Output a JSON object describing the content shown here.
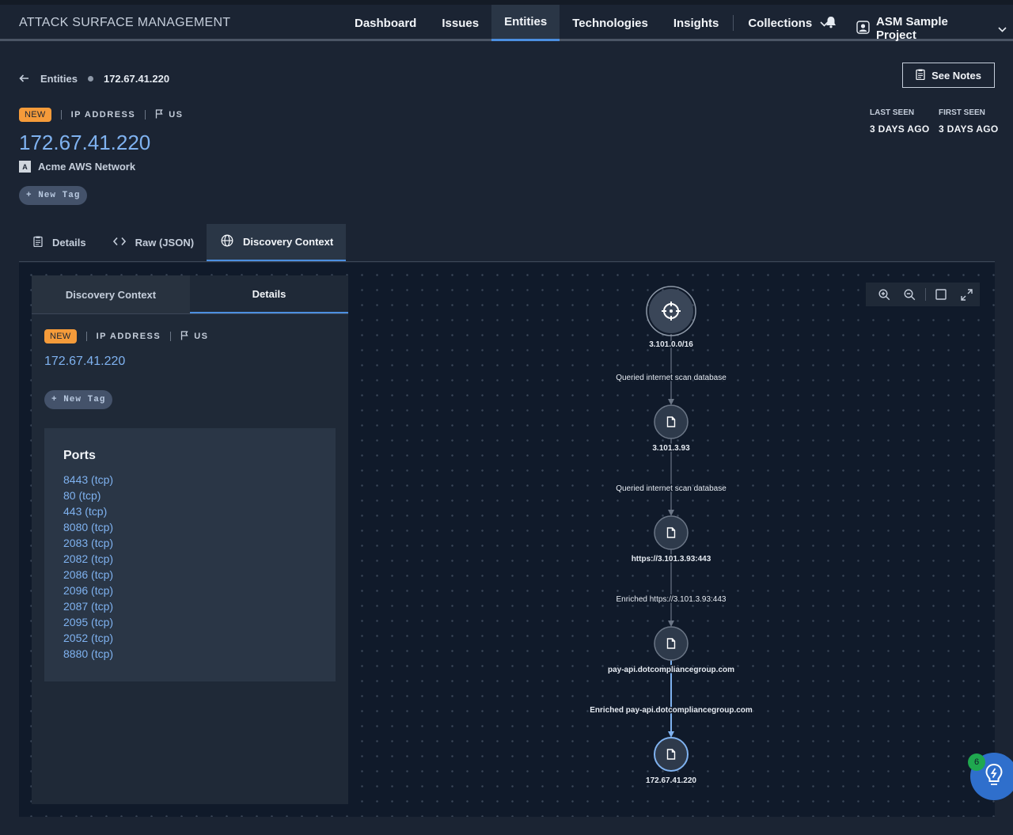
{
  "header": {
    "brand": "ATTACK SURFACE MANAGEMENT",
    "nav": [
      {
        "label": "Dashboard",
        "active": false
      },
      {
        "label": "Issues",
        "active": false
      },
      {
        "label": "Entities",
        "active": true
      },
      {
        "label": "Technologies",
        "active": false
      },
      {
        "label": "Insights",
        "active": false
      },
      {
        "label": "Collections",
        "active": false
      }
    ],
    "project": "ASM Sample Project"
  },
  "breadcrumb": {
    "parent": "Entities",
    "current": "172.67.41.220"
  },
  "see_notes": "See Notes",
  "entity": {
    "badge": "NEW",
    "type": "IP ADDRESS",
    "country": "US",
    "ip": "172.67.41.220",
    "network_letter": "A",
    "network": "Acme AWS Network",
    "new_tag": "+ New Tag",
    "last_seen_label": "LAST SEEN",
    "last_seen": "3 DAYS AGO",
    "first_seen_label": "FIRST SEEN",
    "first_seen": "3 DAYS AGO"
  },
  "tabs": [
    {
      "label": "Details",
      "icon": "clipboard-icon"
    },
    {
      "label": "Raw (JSON)",
      "icon": "code-icon"
    },
    {
      "label": "Discovery Context",
      "icon": "globe-icon",
      "active": true
    }
  ],
  "side_panel": {
    "tabs": [
      "Discovery Context",
      "Details"
    ],
    "active_tab": "Details",
    "badge": "NEW",
    "type": "IP ADDRESS",
    "country": "US",
    "ip": "172.67.41.220",
    "new_tag": "+ New Tag",
    "ports_title": "Ports",
    "ports": [
      "8443 (tcp)",
      "80 (tcp)",
      "443 (tcp)",
      "8080 (tcp)",
      "2083 (tcp)",
      "2082 (tcp)",
      "2086 (tcp)",
      "2096 (tcp)",
      "2087 (tcp)",
      "2095 (tcp)",
      "2052 (tcp)",
      "8880 (tcp)"
    ]
  },
  "graph": {
    "nodes": [
      {
        "label": "3.101.0.0/16",
        "icon": "crosshair-icon"
      },
      {
        "label": "3.101.3.93",
        "icon": "file-icon"
      },
      {
        "label": "https://3.101.3.93:443",
        "icon": "file-icon"
      },
      {
        "label": "pay-api.dotcompliancegroup.com",
        "icon": "file-icon"
      },
      {
        "label": "172.67.41.220",
        "icon": "file-icon"
      }
    ],
    "edges": [
      "Queried internet scan database",
      "Queried internet scan database",
      "Enriched https://3.101.3.93:443",
      "Enriched pay-api.dotcompliancegroup.com"
    ]
  },
  "help_badge": "6"
}
